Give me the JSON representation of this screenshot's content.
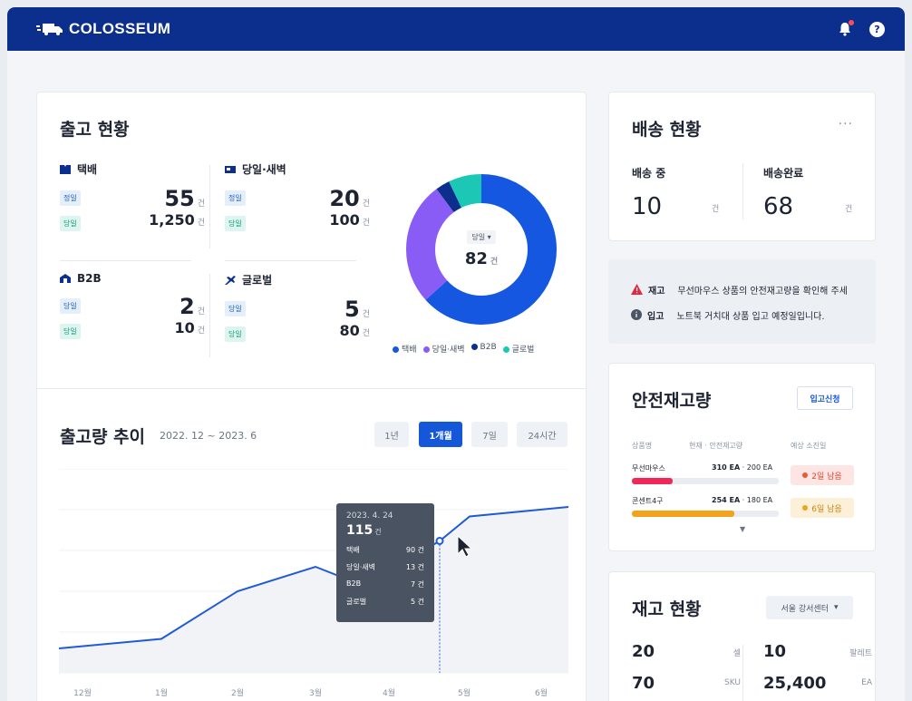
{
  "header": {
    "brand": "COLOSSEUM",
    "help": "?"
  },
  "shipment": {
    "title": "출고 현황",
    "groups": [
      {
        "name": "택배",
        "icon": "box-icon",
        "rows": [
          {
            "pill": "정일",
            "value": "55",
            "unit": "건"
          },
          {
            "pill": "당일",
            "value": "1,250",
            "unit": "건"
          }
        ]
      },
      {
        "name": "당일·새벽",
        "icon": "truck-icon",
        "rows": [
          {
            "pill": "정일",
            "value": "20",
            "unit": "건"
          },
          {
            "pill": "당일",
            "value": "100",
            "unit": "건"
          }
        ]
      },
      {
        "name": "B2B",
        "icon": "building-icon",
        "rows": [
          {
            "pill": "당일",
            "value": "2",
            "unit": "건"
          },
          {
            "pill": "당일",
            "value": "10",
            "unit": "건"
          }
        ]
      },
      {
        "name": "글로벌",
        "icon": "plane-icon",
        "rows": [
          {
            "pill": "당일",
            "value": "5",
            "unit": "건"
          },
          {
            "pill": "당일",
            "value": "80",
            "unit": "건"
          }
        ]
      }
    ],
    "donut": {
      "selector": "당일",
      "total": "82",
      "unit": "건",
      "segments": [
        {
          "name": "택배",
          "value": 62,
          "color": "#1557e0"
        },
        {
          "name": "당일·새벽",
          "value": 26,
          "color": "#8a5cf6"
        },
        {
          "name": "B2B",
          "value": 3,
          "color": "#0c2e8c"
        },
        {
          "name": "글로벌",
          "value": 7,
          "color": "#1cc7b5"
        }
      ]
    }
  },
  "trend": {
    "title": "출고량 추이",
    "period": "2022. 12 ~ 2023. 6",
    "ranges": [
      "1년",
      "1개월",
      "7일",
      "24시간"
    ],
    "active_range": "1개월",
    "tooltip": {
      "date": "2023. 4. 24",
      "total": "115",
      "unit": "건",
      "rows": [
        {
          "label": "택배",
          "value": "90 건"
        },
        {
          "label": "당일·새벽",
          "value": "13 건"
        },
        {
          "label": "B2B",
          "value": "7 건"
        },
        {
          "label": "글로벌",
          "value": "5 건"
        }
      ]
    },
    "x_labels": [
      "12월",
      "1월",
      "2월",
      "3월",
      "4월",
      "5월",
      "6월"
    ]
  },
  "chart_data": {
    "type": "line",
    "x": [
      "12월",
      "1월",
      "2월",
      "3월",
      "3.5월",
      "4월",
      "4.7월",
      "5월",
      "6월"
    ],
    "series": [
      {
        "values": [
          18,
          25,
          60,
          78,
          67,
          75,
          97,
          115,
          122
        ]
      }
    ],
    "ylim": [
      0,
      150
    ],
    "highlight": {
      "x": "2023. 4. 24",
      "value": 115
    },
    "grid": true
  },
  "delivery": {
    "title": "배송 현황",
    "more": "···",
    "cols": [
      {
        "label": "배송 중",
        "value": "10",
        "unit": "건"
      },
      {
        "label": "배송완료",
        "value": "68",
        "unit": "건"
      }
    ]
  },
  "notices": [
    {
      "icon": "warning-icon",
      "tag": "재고",
      "text": "무선마우스 상품의 안전재고량을 확인해 주세",
      "color": "#e0283e"
    },
    {
      "icon": "info-icon",
      "tag": "입고",
      "text": "노트북 거치대 상품 입고 예정일입니다.",
      "color": "#4b5566"
    }
  ],
  "safety": {
    "title": "안전재고량",
    "button": "입고신청",
    "headers": [
      "상품명",
      "현재 · 안전재고량",
      "예상 소진일"
    ],
    "items": [
      {
        "name": "무선마우스",
        "current": "310 EA",
        "safe": "200 EA",
        "level": 0.28,
        "bar_color": "#f0285a",
        "badge": "2일 남음",
        "badge_bg": "#fde5e3",
        "badge_fg": "#e0472e",
        "dot": "#f0572e"
      },
      {
        "name": "콘센트4구",
        "current": "254 EA",
        "safe": "180 EA",
        "level": 0.7,
        "bar_color": "#f3a21b",
        "badge": "6일 남음",
        "badge_bg": "#fdf0d8",
        "badge_fg": "#c98510",
        "dot": "#f3a21b"
      }
    ]
  },
  "inventory": {
    "title": "재고 현황",
    "warehouse": "서울 강서센터",
    "cells": [
      {
        "value": "20",
        "unit": "셀"
      },
      {
        "value": "10",
        "unit": "팔레트"
      },
      {
        "value": "70",
        "unit": "SKU"
      },
      {
        "value": "25,400",
        "unit": "EA"
      }
    ]
  }
}
